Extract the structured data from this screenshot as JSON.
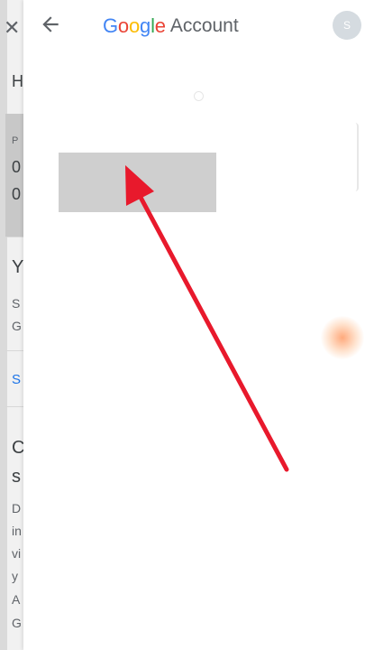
{
  "background_page": {
    "text_lines": [
      "H",
      "P",
      "0",
      "0",
      "Y",
      "S",
      "G",
      "S",
      "C",
      "s",
      "D",
      "in",
      "vi",
      "y",
      "A",
      "G"
    ]
  },
  "header": {
    "title_brand_letters": [
      "G",
      "o",
      "o",
      "g",
      "l",
      "e"
    ],
    "title_brand_colors": [
      "#4285F4",
      "#EA4335",
      "#FBBC05",
      "#4285F4",
      "#34A853",
      "#EA4335"
    ],
    "title_suffix": "Account",
    "avatar_initial": "S"
  },
  "annotation": {
    "arrow_color": "#e8192c"
  },
  "icons": [
    "close-icon",
    "back-arrow-icon"
  ]
}
